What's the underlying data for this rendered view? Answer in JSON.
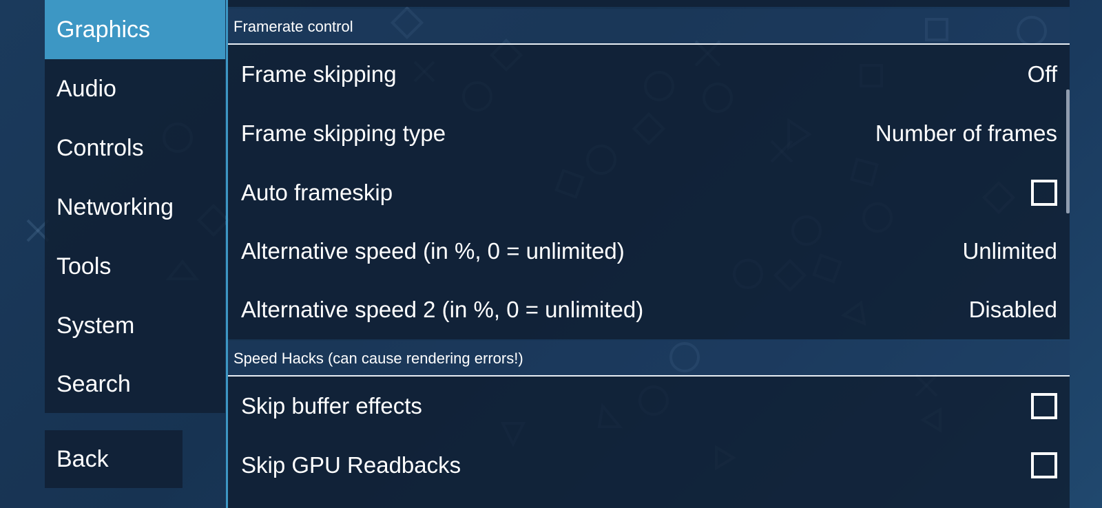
{
  "sidebar": {
    "items": [
      {
        "label": "Graphics",
        "active": true
      },
      {
        "label": "Audio",
        "active": false
      },
      {
        "label": "Controls",
        "active": false
      },
      {
        "label": "Networking",
        "active": false
      },
      {
        "label": "Tools",
        "active": false
      },
      {
        "label": "System",
        "active": false
      },
      {
        "label": "Search",
        "active": false
      }
    ],
    "back_label": "Back"
  },
  "sections": [
    {
      "header": "Framerate control",
      "rows": [
        {
          "label": "Frame skipping",
          "value": "Off",
          "type": "value"
        },
        {
          "label": "Frame skipping type",
          "value": "Number of frames",
          "type": "value"
        },
        {
          "label": "Auto frameskip",
          "checked": false,
          "type": "checkbox"
        },
        {
          "label": "Alternative speed (in %, 0 = unlimited)",
          "value": "Unlimited",
          "type": "value"
        },
        {
          "label": "Alternative speed 2 (in %, 0 = unlimited)",
          "value": "Disabled",
          "type": "value"
        }
      ]
    },
    {
      "header": "Speed Hacks (can cause rendering errors!)",
      "rows": [
        {
          "label": "Skip buffer effects",
          "checked": false,
          "type": "checkbox"
        },
        {
          "label": "Skip GPU Readbacks",
          "checked": false,
          "type": "checkbox"
        }
      ]
    }
  ],
  "colors": {
    "accent": "#3d97c4",
    "panel": "#101e32",
    "background": "#1b3a5c"
  }
}
